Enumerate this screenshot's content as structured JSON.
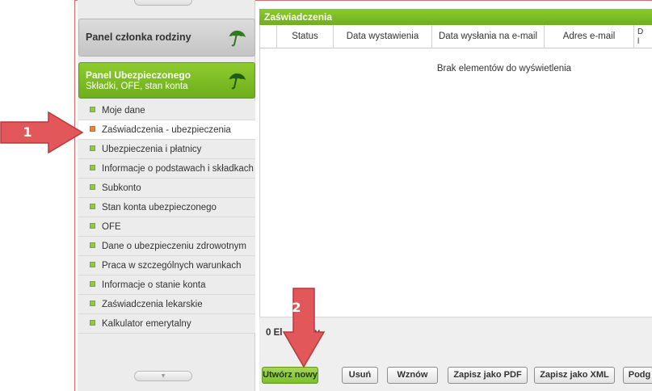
{
  "sidebar": {
    "family_panel": {
      "title": "Panel członka rodziny",
      "icon": "umbrella-icon"
    },
    "insured_panel": {
      "title": "Panel Ubezpieczonego",
      "subtitle": "Składki, OFE, stan konta",
      "icon": "umbrella-icon"
    },
    "items": [
      {
        "label": "Moje dane"
      },
      {
        "label": "Zaświadczenia - ubezpieczenia",
        "active": true
      },
      {
        "label": "Ubezpieczenia i płatnicy"
      },
      {
        "label": "Informacje o podstawach i składkach"
      },
      {
        "label": "Subkonto"
      },
      {
        "label": "Stan konta ubezpieczonego"
      },
      {
        "label": "OFE"
      },
      {
        "label": "Dane o ubezpieczeniu zdrowotnym"
      },
      {
        "label": "Praca w szczególnych warunkach"
      },
      {
        "label": "Informacje o stanie konta"
      },
      {
        "label": "Zaświadczenia lekarskie"
      },
      {
        "label": "Kalkulator emerytalny"
      }
    ]
  },
  "grid": {
    "title": "Zaświadczenia",
    "columns": [
      "Status",
      "Data wystawienia",
      "Data wysłania na e-mail",
      "Adres e-mail",
      "D\nl"
    ],
    "empty_message": "Brak elementów do wyświetlenia",
    "count_text": "0 El"
  },
  "toolbar": {
    "buttons": [
      "Utwórz nowy",
      "Usuń",
      "Wznów",
      "Zapisz jako PDF",
      "Zapisz jako XML",
      "Podg"
    ]
  },
  "annotations": {
    "marker1": "1",
    "marker2": "2",
    "suffix_partial": "y"
  },
  "colors": {
    "accent_green": "#7cbf2e",
    "annotation_red": "#e2585a",
    "active_bullet": "#e2883b"
  }
}
